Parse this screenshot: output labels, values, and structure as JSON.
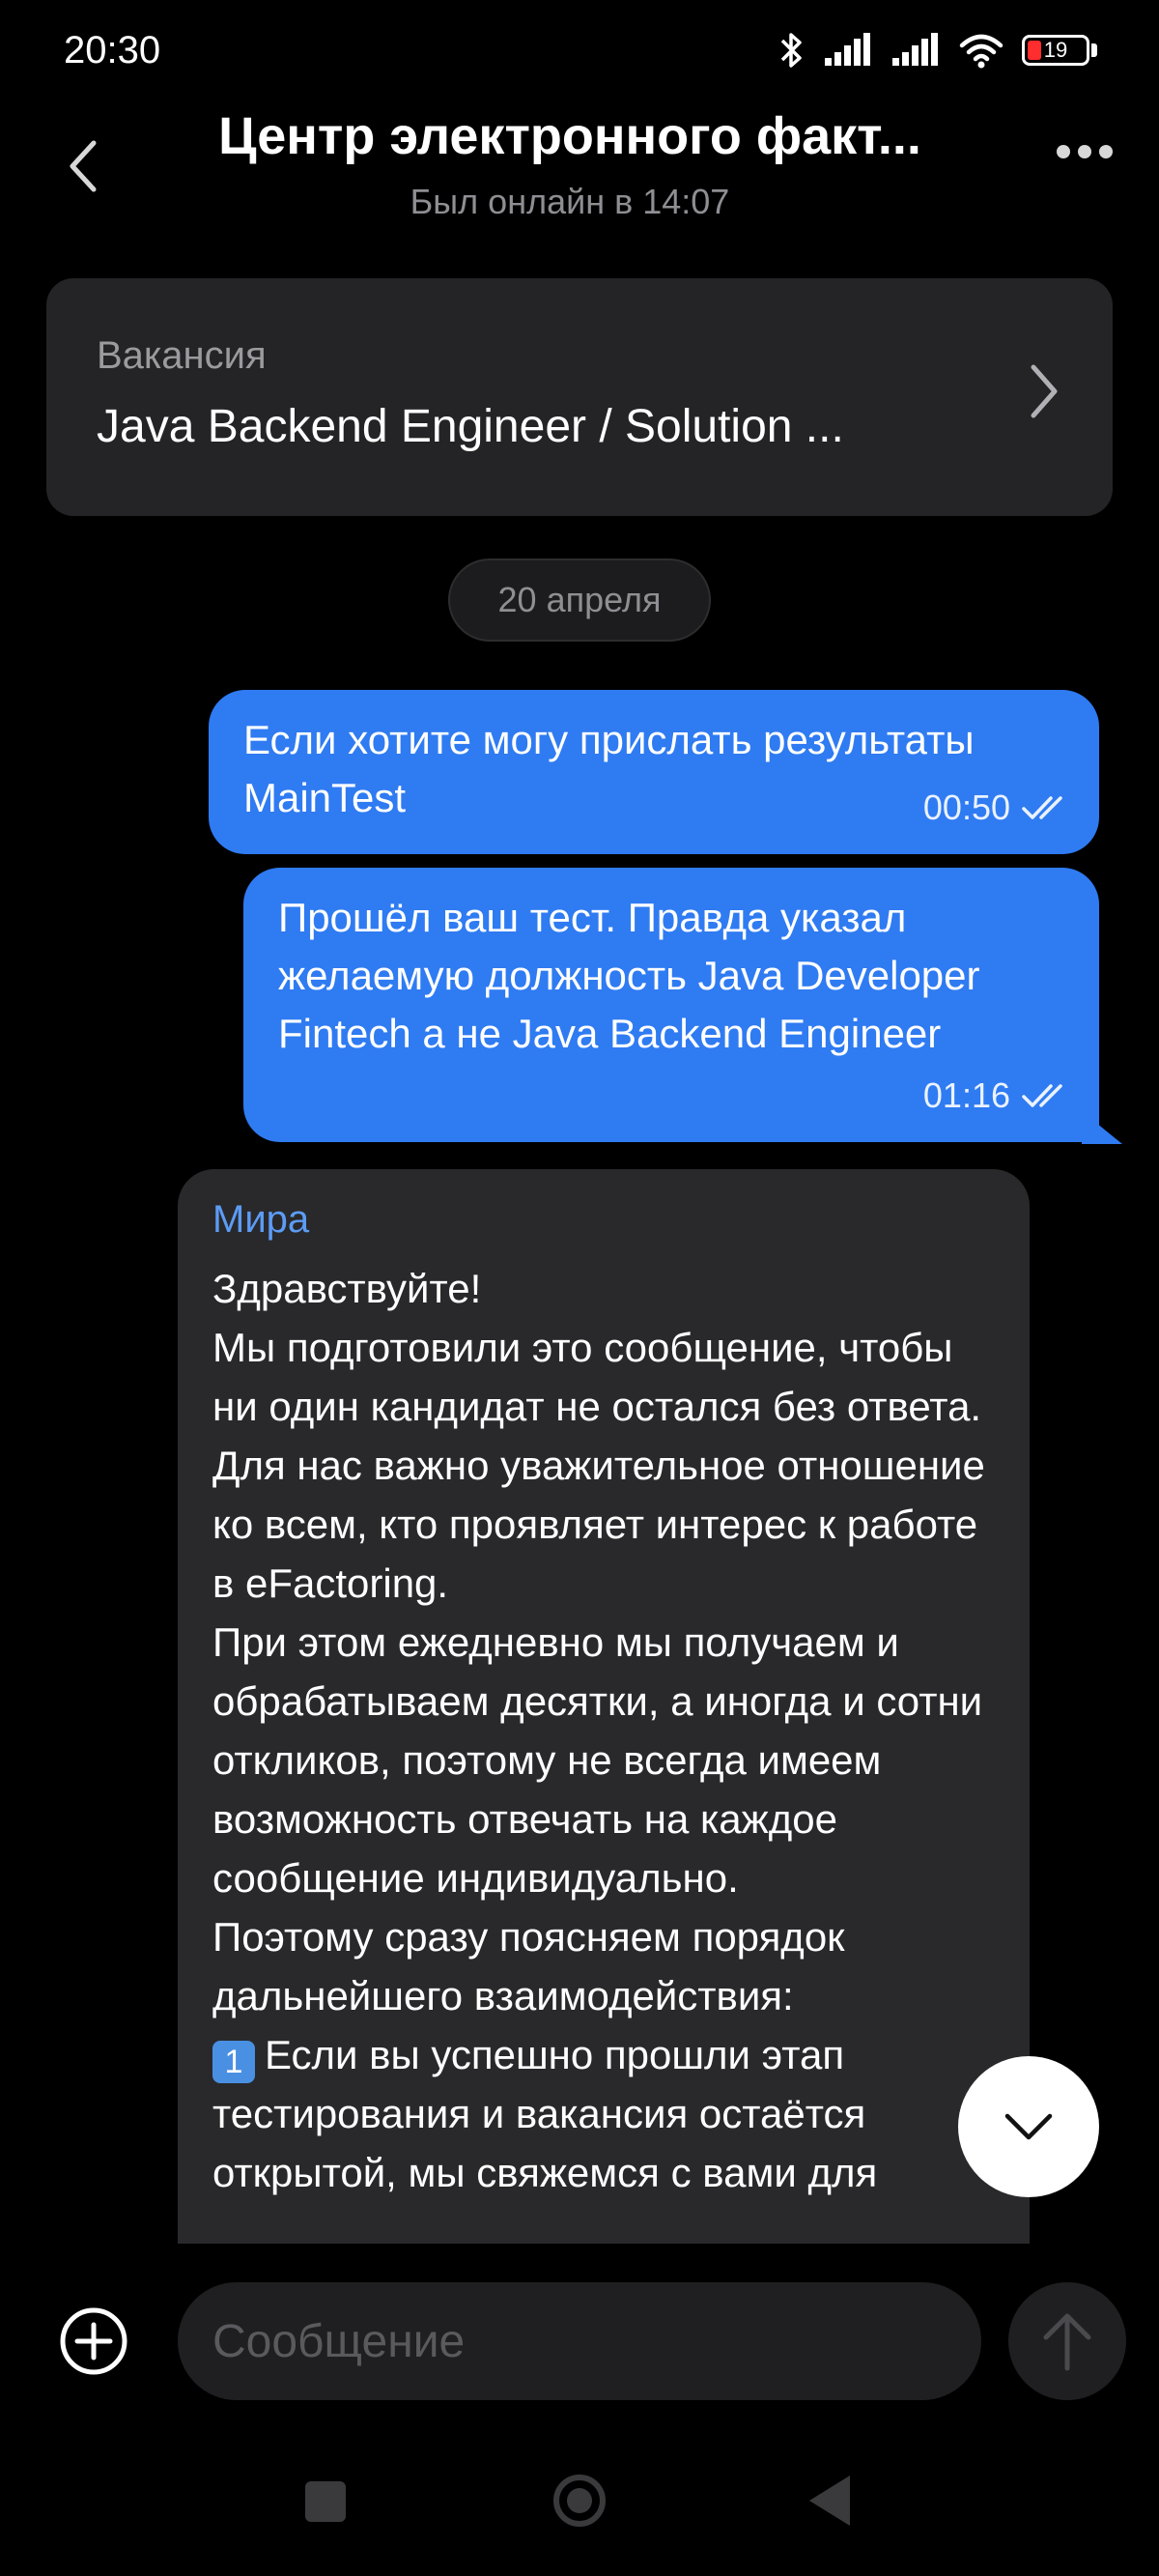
{
  "status_bar": {
    "time": "20:30",
    "battery": "19",
    "battery_color": "#ff2d2d"
  },
  "header": {
    "title": "Центр электронного факт...",
    "subtitle": "Был онлайн в 14:07",
    "back_icon": "chevron-left-icon",
    "more_icon": "more-dots-icon"
  },
  "vacancy": {
    "label": "Вакансия",
    "title": "Java Backend Engineer / Solution ..."
  },
  "date_separator": "20 апреля",
  "messages": [
    {
      "direction": "outgoing",
      "text": "Если хотите могу прислать результаты MainTest",
      "time": "00:50",
      "status": "read"
    },
    {
      "direction": "outgoing",
      "text": "Прошёл ваш тест. Правда указал желаемую должность Java Developer Fintech а не Java Backend Engineer",
      "time": "01:16",
      "status": "read"
    },
    {
      "direction": "incoming",
      "sender": "Мира",
      "text": "Здравствуйте!\nМы подготовили это сообщение, чтобы ни один кандидат не остался без ответа. Для нас важно уважительное отношение ко всем, кто проявляет интерес к работе в eFactoring.\nПри этом ежедневно мы получаем и обрабатываем десятки, а иногда и сотни откликов, поэтому не всегда имеем возможность отвечать на каждое сообщение индивидуально.\nПоэтому сразу поясняем порядок дальнейшего взаимодействия:",
      "list_marker": "1",
      "list_text": "Если вы успешно прошли этап тестирования и вакансия остаётся открытой, мы свяжемся с вами для"
    }
  ],
  "composer": {
    "placeholder": "Сообщение"
  },
  "colors": {
    "accent": "#2f7bf2",
    "sender_name": "#5c9cf5",
    "incoming_bubble": "#29292b",
    "background": "#000000"
  }
}
